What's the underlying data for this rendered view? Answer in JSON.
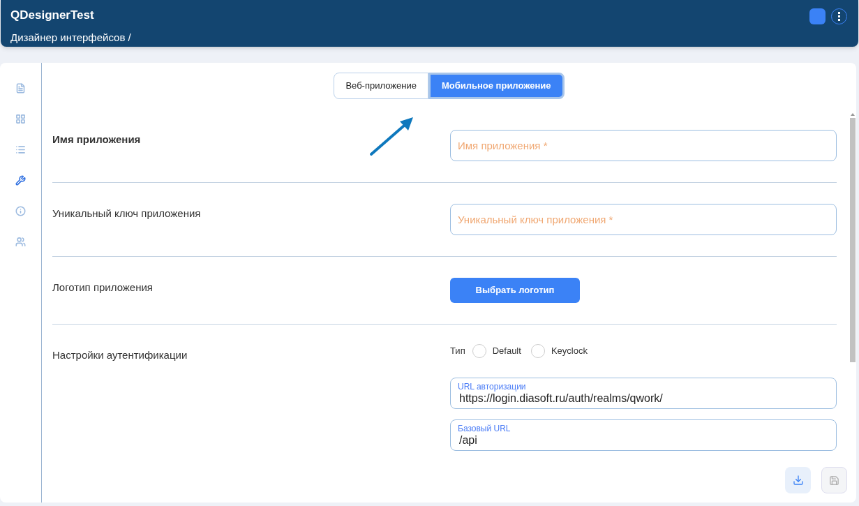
{
  "header": {
    "title": "QDesignerTest",
    "breadcrumb": "Дизайнер интерфейсов /"
  },
  "sidebar": {
    "items": [
      {
        "selected": false
      },
      {
        "selected": false
      },
      {
        "selected": false
      },
      {
        "selected": true
      },
      {
        "selected": false
      },
      {
        "selected": false
      }
    ]
  },
  "mode_tabs": [
    {
      "label": "Веб-приложение",
      "selected": false
    },
    {
      "label": "Мобильное приложение",
      "selected": true
    }
  ],
  "rows": [
    {
      "kind": "field",
      "label": "Имя приложения",
      "bold": true,
      "placeholder": "Имя приложения *"
    },
    {
      "kind": "field",
      "label": "Уникальный ключ приложения",
      "bold": false,
      "placeholder": "Уникальный ключ приложения *"
    },
    {
      "kind": "button",
      "label": "Логотип приложения",
      "button": "Выбрать логотип"
    },
    {
      "kind": "auth",
      "label": "Настройки аутентификации",
      "type_label": "Тип",
      "options": [
        {
          "label": "Default",
          "selected": false
        },
        {
          "label": "Keyclock",
          "selected": false
        }
      ],
      "fields": [
        {
          "label": "URL авторизации",
          "value": "https://login.diasoft.ru/auth/realms/qwork/"
        },
        {
          "label": "Базовый URL",
          "value": "/api"
        }
      ]
    }
  ]
}
